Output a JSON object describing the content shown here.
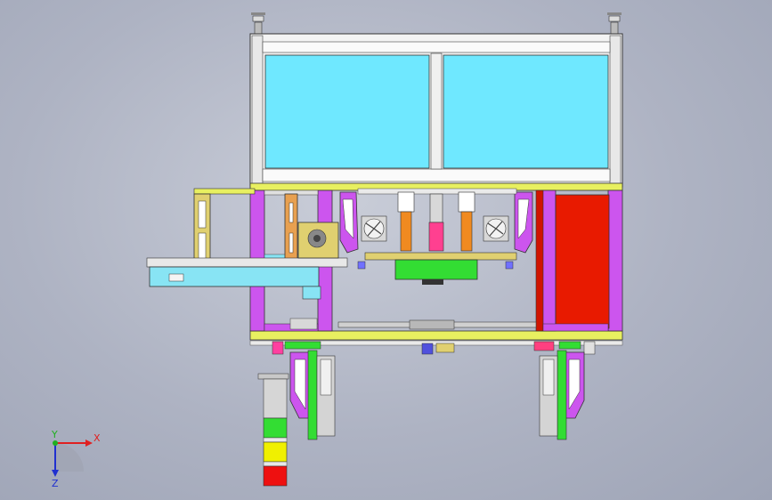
{
  "viewport": {
    "background": "#b4b9c8"
  },
  "axis_triad": {
    "x_label": "X",
    "y_label": "Y",
    "z_label": "Z",
    "x_color": "#e02020",
    "y_color": "#20b020",
    "z_color": "#2030d0"
  },
  "colors": {
    "glass": "#6fe8ff",
    "frame": "#ffffff",
    "post_magenta": "#cc55ee",
    "bracket_orange": "#e8a050",
    "rail_yellow": "#e8f060",
    "green": "#33dd33",
    "red_panel": "#e81a00",
    "cyan_conveyor": "#88e4f4",
    "khaki": "#e0d070",
    "violet": "#7070ff",
    "orange_cylinder": "#f08a20",
    "pink_cylinder": "#ff4090",
    "tower_green": "#33dd33",
    "tower_yellow": "#f0f000",
    "tower_red": "#ee1010"
  }
}
